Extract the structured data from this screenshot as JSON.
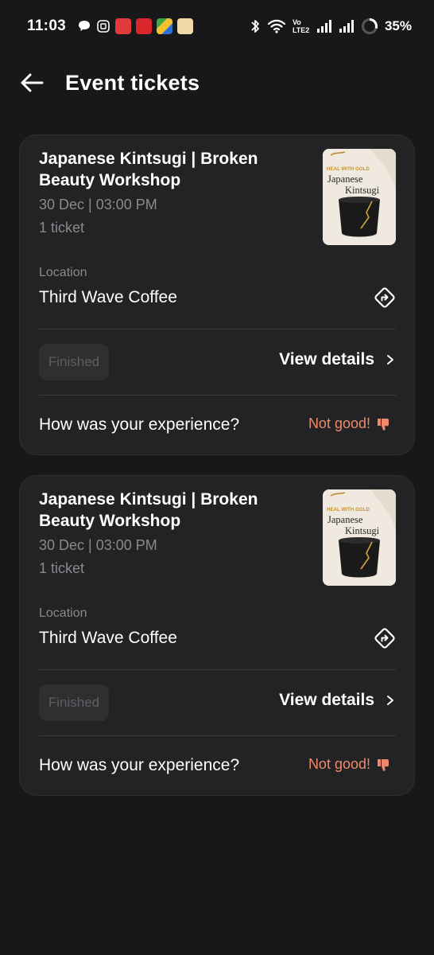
{
  "status_bar": {
    "time": "11:03",
    "battery": "35%",
    "network_label": "Vo LTE2",
    "icons": [
      "chat-bubble-icon",
      "shield-app-icon",
      "app-red-icon",
      "app-jiomart-icon",
      "app-multicolor-icon",
      "app-amazon-icon",
      "bluetooth-icon",
      "wifi-icon",
      "volte-icon",
      "signal-icon",
      "signal-icon",
      "battery-ring-icon"
    ]
  },
  "header": {
    "title": "Event tickets",
    "back_icon": "arrow-left-icon"
  },
  "colors": {
    "background": "#18181a",
    "card": "#232325",
    "muted_text": "#8a8a8e",
    "accent_negative": "#ee8a6b",
    "badge_bg": "#2f2f31"
  },
  "tickets": [
    {
      "title": "Japanese Kintsugi | Broken Beauty Workshop",
      "date_time": "30 Dec | 03:00 PM",
      "count": "1 ticket",
      "poster": {
        "tagline": "HEAL WITH GOLD",
        "line1": "Japanese",
        "line2": "Kintsugi"
      },
      "location_label": "Location",
      "location": "Third Wave Coffee",
      "status": "Finished",
      "view_details": "View details",
      "feedback_question": "How was your experience?",
      "feedback": "Not good!"
    },
    {
      "title": "Japanese Kintsugi | Broken Beauty Workshop",
      "date_time": "30 Dec | 03:00 PM",
      "count": "1 ticket",
      "poster": {
        "tagline": "HEAL WITH GOLD",
        "line1": "Japanese",
        "line2": "Kintsugi"
      },
      "location_label": "Location",
      "location": "Third Wave Coffee",
      "status": "Finished",
      "view_details": "View details",
      "feedback_question": "How was your experience?",
      "feedback": "Not good!"
    }
  ]
}
